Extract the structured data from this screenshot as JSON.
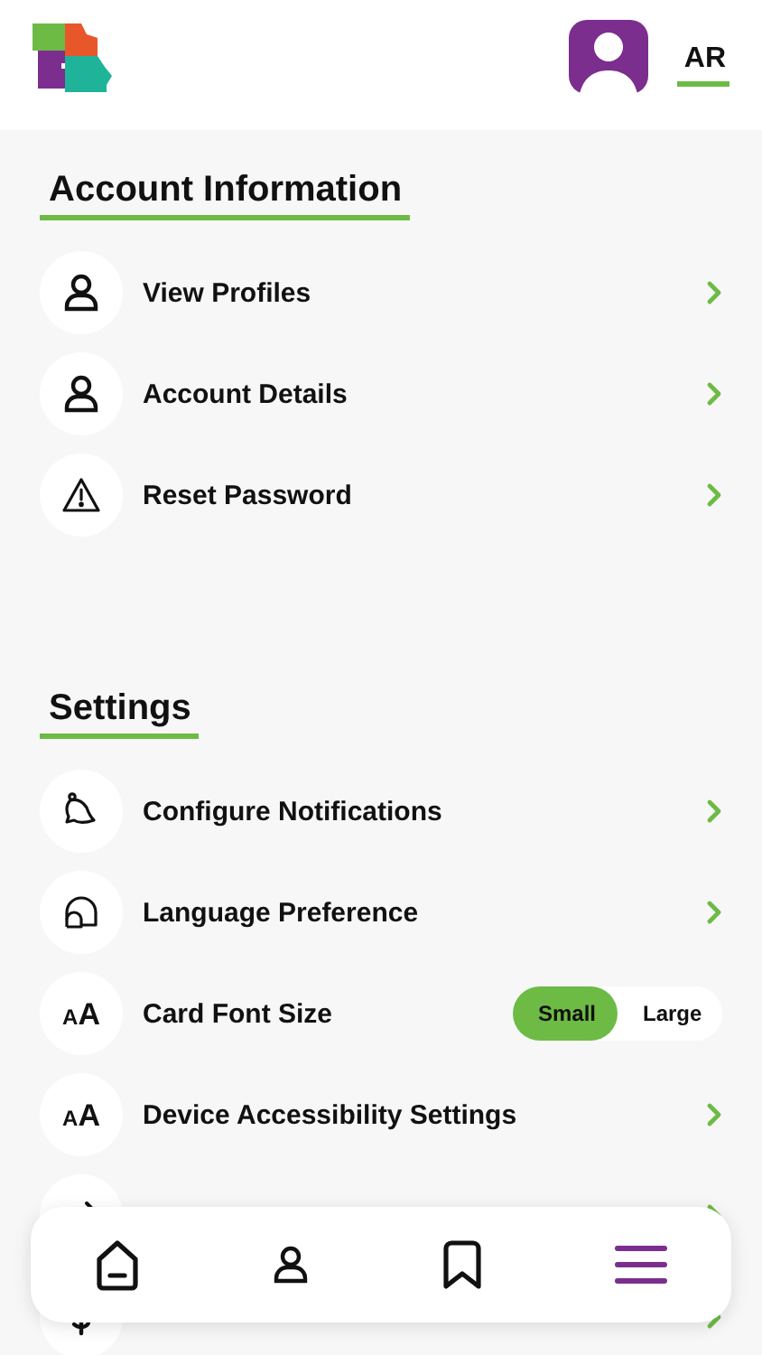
{
  "header": {
    "initials": "AR"
  },
  "sections": [
    {
      "title": "Account Information",
      "items": [
        {
          "kind": "link",
          "label": "View Profiles"
        },
        {
          "kind": "link",
          "label": "Account Details"
        },
        {
          "kind": "link",
          "label": "Reset Password"
        }
      ]
    },
    {
      "title": "Settings",
      "items": [
        {
          "kind": "link",
          "label": "Configure Notifications"
        },
        {
          "kind": "link",
          "label": "Language Preference"
        },
        {
          "kind": "toggle",
          "glyph": "AA",
          "label": "Card Font Size",
          "options": [
            {
              "label": "Small",
              "selected": true
            },
            {
              "label": "Large",
              "selected": false
            }
          ]
        },
        {
          "kind": "link",
          "glyph": "AA",
          "label": "Device Accessibility Settings"
        },
        {
          "kind": "link"
        },
        {
          "kind": "link"
        }
      ]
    }
  ],
  "nav": [
    {
      "selected": false
    },
    {
      "selected": false
    },
    {
      "selected": false
    },
    {
      "selected": true
    }
  ]
}
